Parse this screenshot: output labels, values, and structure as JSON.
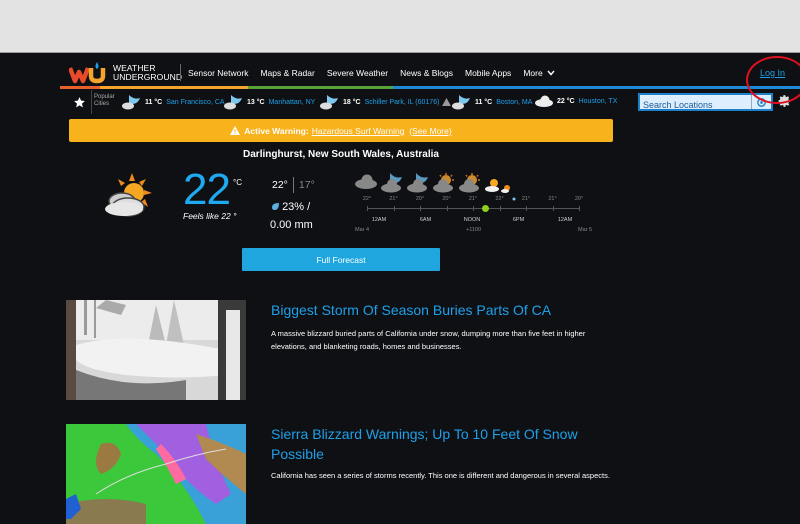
{
  "browser": {},
  "nav": {
    "brand_line1": "WEATHER",
    "brand_line2": "UNDERGROUND",
    "links": [
      "Sensor Network",
      "Maps & Radar",
      "Severe Weather",
      "News & Blogs",
      "Mobile Apps",
      "More"
    ],
    "login": "Log In",
    "colorbar": [
      "#e8612a",
      "#f4a42c",
      "#5aa33a",
      "#1e8ad6"
    ]
  },
  "cities": {
    "label_line1": "Popular",
    "label_line2": "Cities",
    "items": [
      {
        "temp": "11 °C",
        "name": "San Francisco, CA",
        "icon": "partly-cloudy-night-icon"
      },
      {
        "temp": "13 °C",
        "name": "Manhattan, NY",
        "icon": "partly-cloudy-night-icon"
      },
      {
        "temp": "18 °C",
        "name": "Schiller Park, IL (60176)",
        "icon": "partly-cloudy-night-icon",
        "alert": true
      },
      {
        "temp": "11 °C",
        "name": "Boston, MA",
        "icon": "partly-cloudy-night-icon"
      },
      {
        "temp": "22 °C",
        "name": "Houston, TX",
        "icon": "cloudy-icon"
      }
    ],
    "search_placeholder": "Search Locations"
  },
  "warning": {
    "prefix": "Active Warning:",
    "link": "Hazardous Surf Warning",
    "more": "(See More)",
    "color": "#f8b21c"
  },
  "current": {
    "location": "Darlinghurst, New South Wales, Australia",
    "temp": "22",
    "unit": "°C",
    "feels_like": "Feels like 22 °",
    "high": "22°",
    "low": "17°",
    "precip_chance": "23% /",
    "precip_amount": "0.00 mm",
    "accent": "#1eaaf0"
  },
  "hourly": {
    "temps": [
      "22°",
      "21°",
      "20°",
      "20°",
      "21°",
      "22°",
      "21°",
      "21°",
      "20°"
    ],
    "labels": [
      "12AM",
      "6AM",
      "NOON",
      "6PM",
      "12AM"
    ],
    "date_start": "Mar 4",
    "timezone": "+1100",
    "date_end": "Mar 5"
  },
  "full_forecast": "Full Forecast",
  "news": [
    {
      "title": "Biggest Storm Of Season Buries Parts Of CA",
      "desc": "A massive blizzard buried parts of California under snow, dumping more than five feet in higher elevations, and blanketing roads, homes and businesses."
    },
    {
      "title": "Sierra Blizzard Warnings; Up To 10 Feet Of Snow Possible",
      "desc": "California has seen a series of storms recently. This one is different and dangerous in several aspects."
    }
  ]
}
